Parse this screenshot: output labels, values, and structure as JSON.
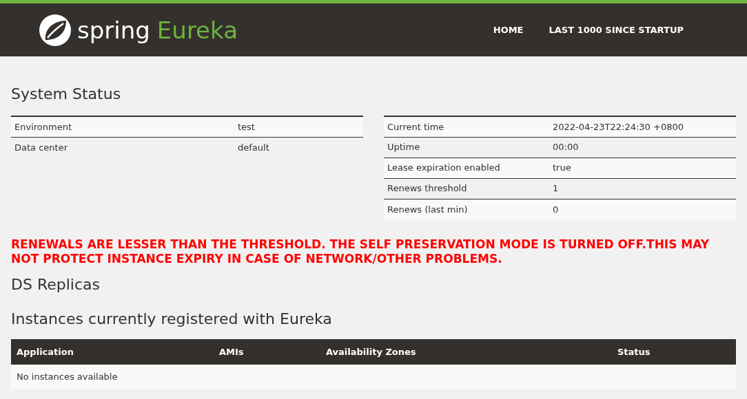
{
  "header": {
    "logo_text": "spring",
    "logo_accent": "Eureka",
    "nav": [
      "HOME",
      "LAST 1000 SINCE STARTUP"
    ]
  },
  "system_status": {
    "title": "System Status",
    "left_table": [
      {
        "label": "Environment",
        "value": "test"
      },
      {
        "label": "Data center",
        "value": "default"
      }
    ],
    "right_table": [
      {
        "label": "Current time",
        "value": "2022-04-23T22:24:30 +0800"
      },
      {
        "label": "Uptime",
        "value": "00:00"
      },
      {
        "label": "Lease expiration enabled",
        "value": "true"
      },
      {
        "label": "Renews threshold",
        "value": "1"
      },
      {
        "label": "Renews (last min)",
        "value": "0"
      }
    ]
  },
  "warning": "RENEWALS ARE LESSER THAN THE THRESHOLD. THE SELF PRESERVATION MODE IS TURNED OFF.THIS MAY NOT PROTECT INSTANCE EXPIRY IN CASE OF NETWORK/OTHER PROBLEMS.",
  "replicas": {
    "title": "DS Replicas"
  },
  "instances": {
    "title": "Instances currently registered with Eureka",
    "columns": [
      "Application",
      "AMIs",
      "Availability Zones",
      "Status"
    ],
    "empty_message": "No instances available"
  }
}
